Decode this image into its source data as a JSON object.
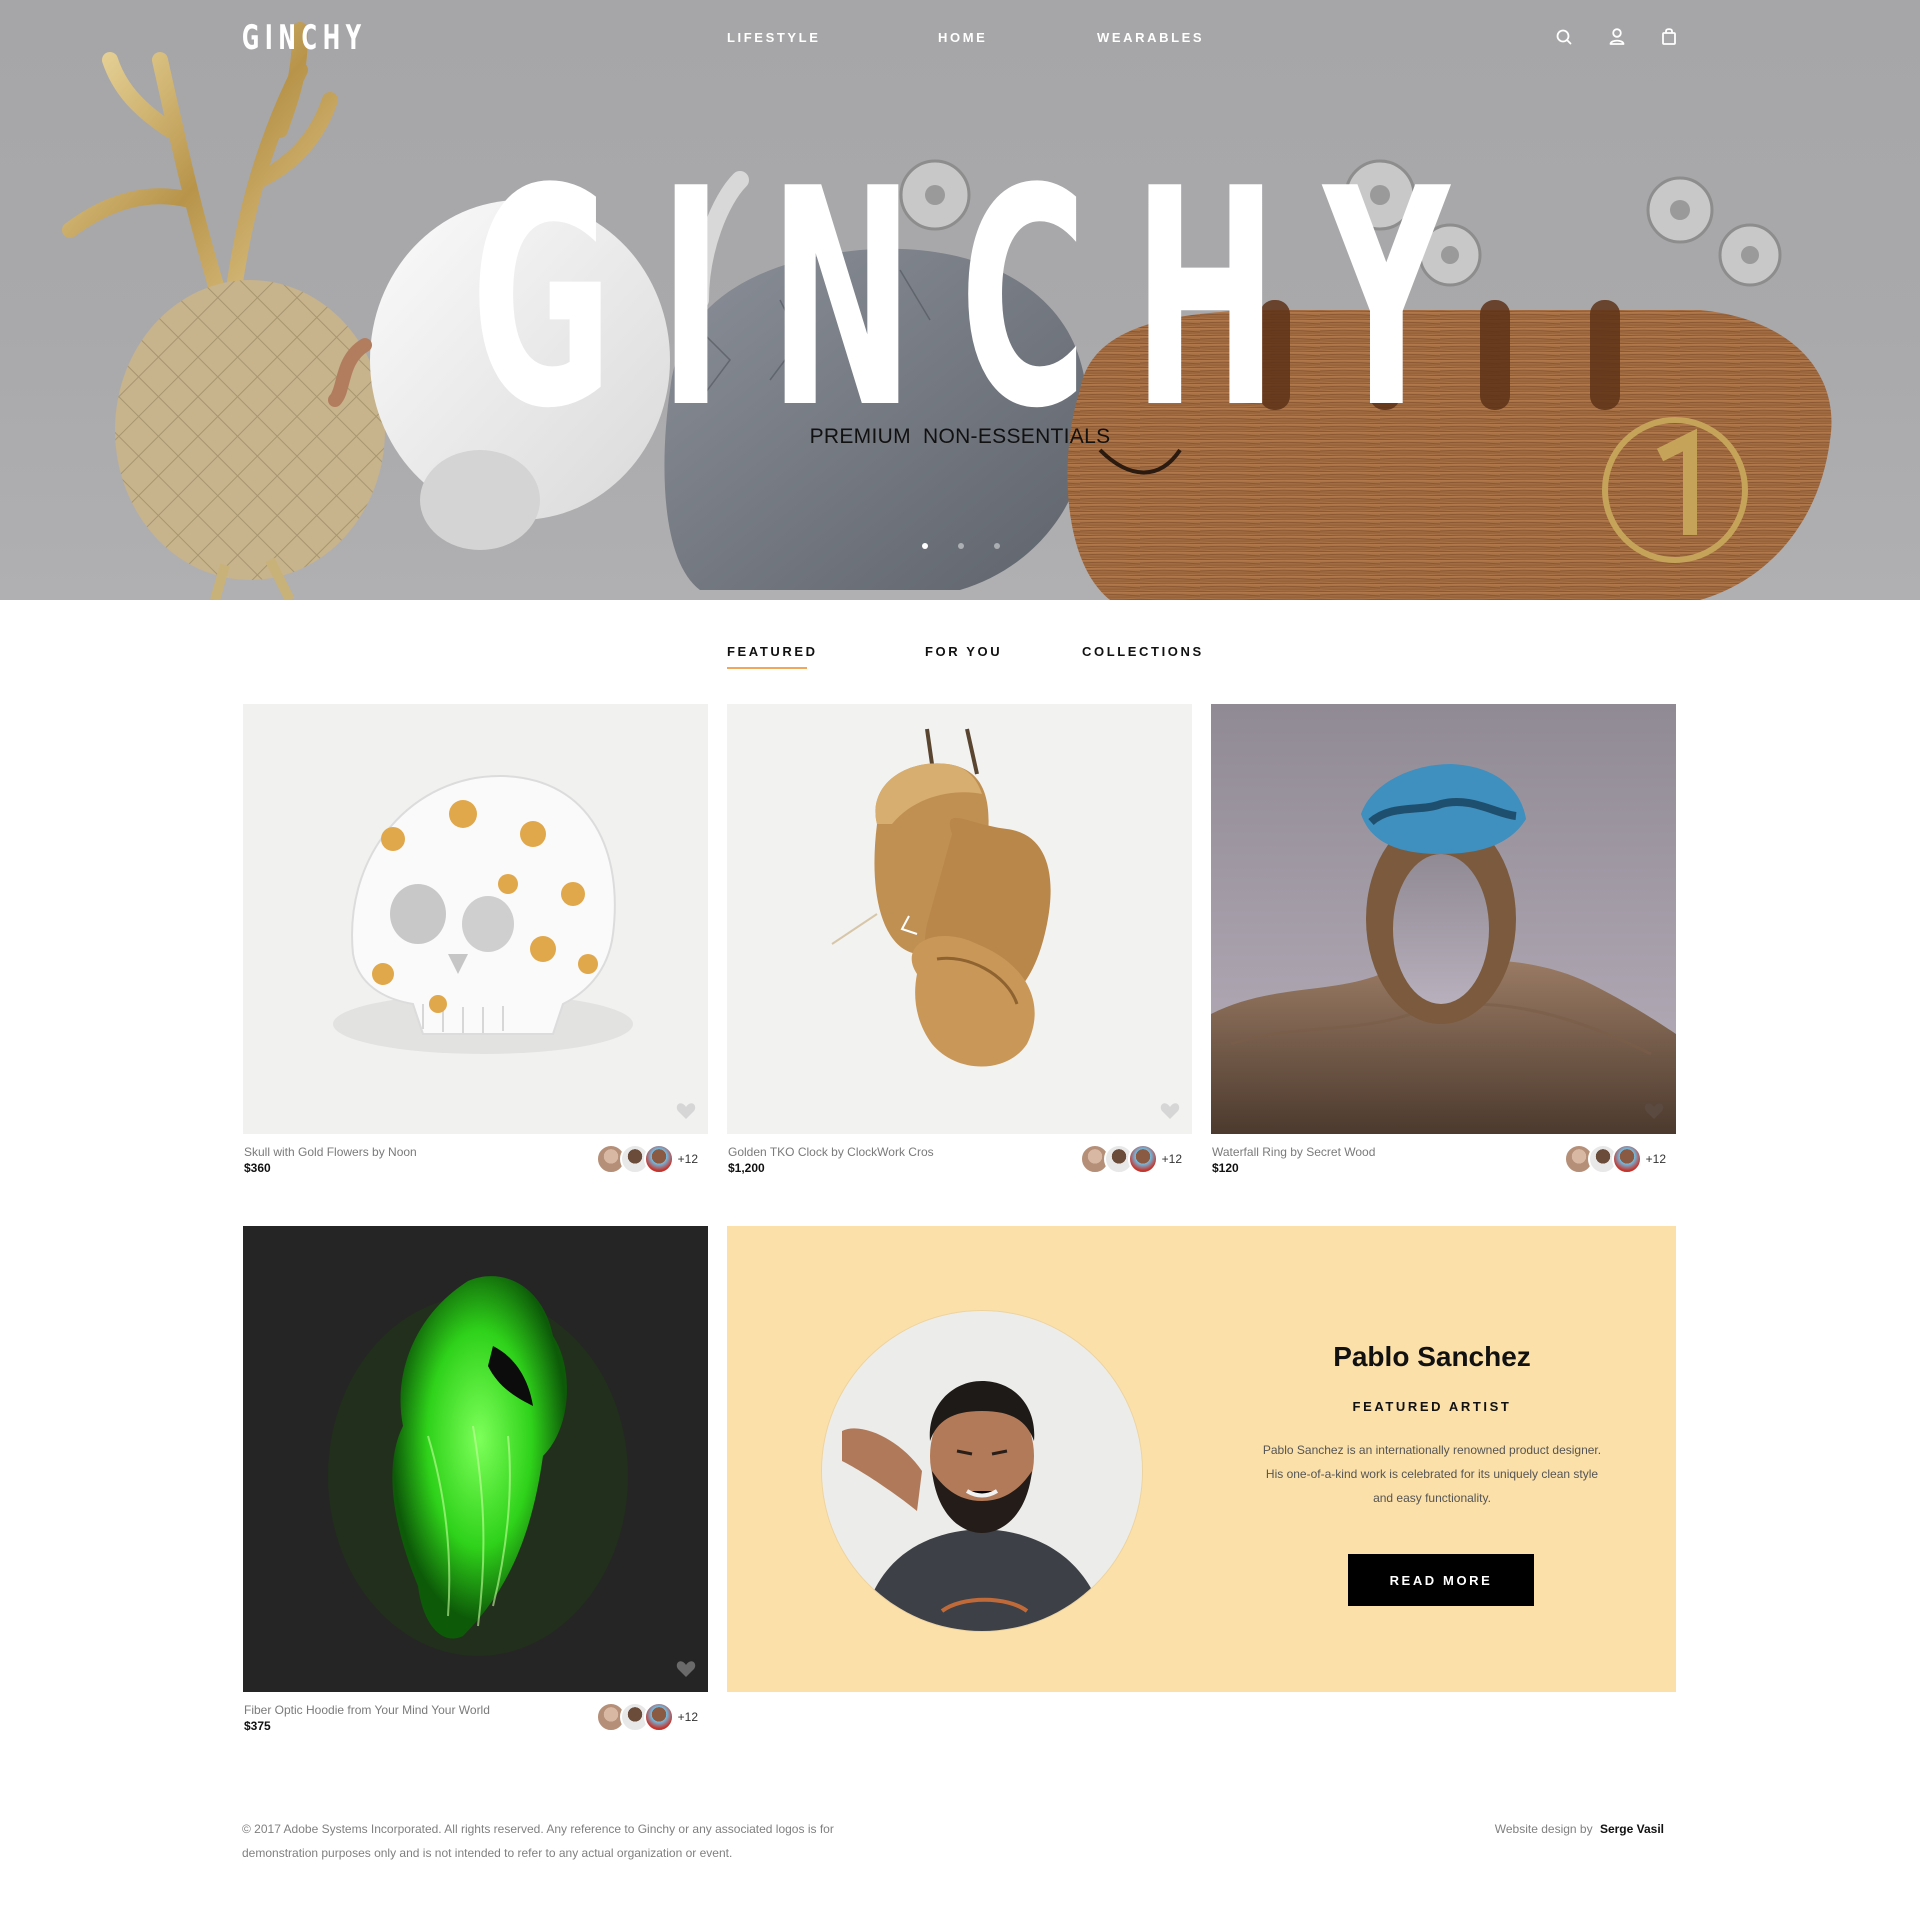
{
  "nav": {
    "logo": "GINCHY",
    "links": [
      "LIFESTYLE",
      "HOME",
      "WEARABLES"
    ],
    "icons": [
      "search-icon",
      "user-icon",
      "shopping-bag-icon"
    ]
  },
  "hero": {
    "title": "GINCHY",
    "subtitle": "PREMIUM  NON-ESSENTIALS",
    "slides": 3,
    "active_slide": 1
  },
  "tabs": {
    "items": [
      "FEATURED",
      "FOR YOU",
      "COLLECTIONS"
    ],
    "active": "FEATURED"
  },
  "products": [
    {
      "title": "Skull with Gold Flowers by Noon",
      "price": "$360",
      "extra_likes": "+12",
      "image": "porcelain skull with gold flowers"
    },
    {
      "title": "Golden TKO Clock by ClockWork Cros",
      "price": "$1,200",
      "extra_likes": "+12",
      "image": "golden boxing gloves clock"
    },
    {
      "title": "Waterfall Ring by Secret Wood",
      "price": "$120",
      "extra_likes": "+12",
      "image": "wooden ring with blue resin on rock"
    },
    {
      "title": "Fiber Optic Hoodie from Your Mind Your World",
      "price": "$375",
      "extra_likes": "+12",
      "image": "glowing green fiber optic hoodie"
    }
  ],
  "artist": {
    "name": "Pablo Sanchez",
    "role": "FEATURED ARTIST",
    "bio": "Pablo Sanchez is an internationally renowned product designer. His one-of-a-kind work is celebrated for its uniquely clean style and easy functionality.",
    "cta": "READ MORE",
    "panel_color": "#fbe0a9"
  },
  "footer": {
    "copyright": "© 2017 Adobe Systems Incorporated. All rights reserved. Any reference to Ginchy or any associated logos is for demonstration purposes only and is not intended to refer to any actual organization or event.",
    "credit_prefix": "Website design by",
    "credit_name": "Serge Vasil"
  },
  "colors": {
    "accent": "#f2a65a",
    "hero_bg": "#a9a9ab",
    "button": "#000000"
  }
}
